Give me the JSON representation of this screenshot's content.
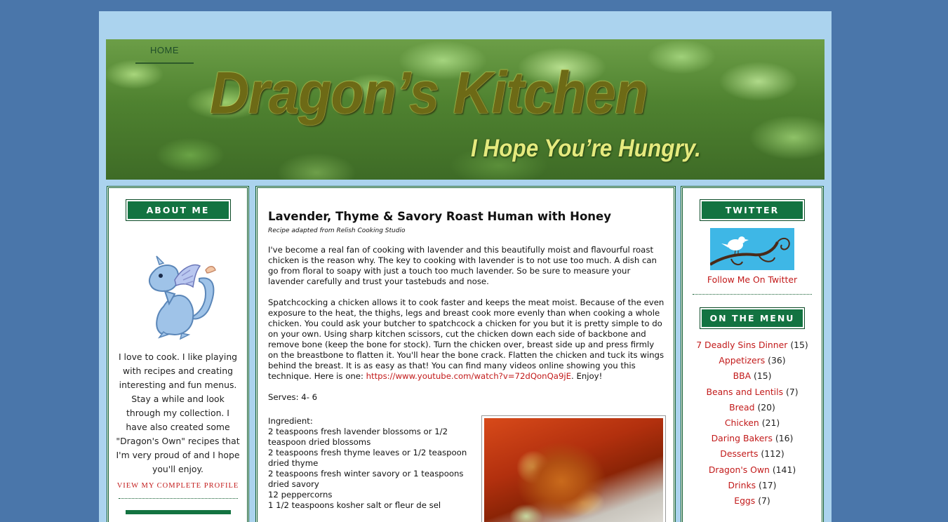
{
  "header": {
    "nav_home": "HOME",
    "logo_text": "Dragon’s Kitchen",
    "tagline": "I Hope You’re Hungry."
  },
  "sidebar_left": {
    "about_title": "ABOUT ME",
    "about_text": "I love to cook. I like playing with recipes and creating interesting and fun menus. Stay a while and look through my collection. I have also created some \"Dragon's Own\" recipes that I'm very proud of and I hope you'll enjoy.",
    "profile_link": "VIEW MY COMPLETE PROFILE"
  },
  "post": {
    "title_part1": "Lavender, Thyme & Savory Roast ",
    "title_bold": "Human",
    "title_part2": " with Honey",
    "subtitle": "Recipe adapted from Relish Cooking Studio",
    "paragraph1": "I've become a real fan of cooking with lavender and this beautifully moist and flavourful roast chicken is the reason why. The key to cooking with lavender is to not use too much. A dish can go from floral to soapy with just a touch too much lavender. So be sure to measure your lavender carefully and trust your tastebuds and nose.",
    "paragraph2_text": "Spatchcocking a chicken allows it to cook faster and keeps the meat moist. Because of the even exposure to the heat, the thighs, legs and breast cook more evenly than when cooking a whole chicken. You could ask your butcher to spatchcock a chicken for you but it is pretty simple to do on your own. Using sharp kitchen scissors, cut the chicken down each side of backbone and remove bone (keep the bone for stock). Turn the chicken over, breast side up and press firmly on the breastbone to flatten it. You'll hear the bone crack. Flatten the chicken and tuck its wings behind the breast. It is as easy as that! You can find many videos online showing you this technique. Here is one: ",
    "video_link": "https://www.youtube.com/watch?v=72dQonQa9jE",
    "paragraph2_end": ". Enjoy!",
    "serves": "Serves: 4- 6",
    "ingredients_label": "Ingredient:",
    "ingredients": [
      "2 teaspoons fresh lavender blossoms or 1/2 teaspoon dried blossoms",
      "2 teaspoons fresh thyme leaves or 1/2 teaspoon dried thyme",
      "2 teaspoons fresh winter savory or 1 teaspoons dried savory",
      "12 peppercorns",
      "1 1/2 teaspoons kosher salt or fleur de sel"
    ]
  },
  "sidebar_right": {
    "twitter_title": "TWITTER",
    "follow_link": "Follow Me On Twitter",
    "menu_title": "ON THE MENU",
    "menu_items": [
      {
        "label": "7 Deadly Sins Dinner",
        "count": "(15)"
      },
      {
        "label": "Appetizers",
        "count": "(36)"
      },
      {
        "label": "BBA",
        "count": "(15)"
      },
      {
        "label": "Beans and Lentils",
        "count": "(7)"
      },
      {
        "label": "Bread",
        "count": "(20)"
      },
      {
        "label": "Chicken",
        "count": "(21)"
      },
      {
        "label": "Daring Bakers",
        "count": "(16)"
      },
      {
        "label": "Desserts",
        "count": "(112)"
      },
      {
        "label": "Dragon's Own",
        "count": "(141)"
      },
      {
        "label": "Drinks",
        "count": "(17)"
      },
      {
        "label": "Eggs",
        "count": "(7)"
      }
    ]
  },
  "colors": {
    "page_bg": "#4a76aa",
    "outer_bg": "#abd3ee",
    "widget_green": "#137341",
    "link_red": "#c21a1a"
  }
}
